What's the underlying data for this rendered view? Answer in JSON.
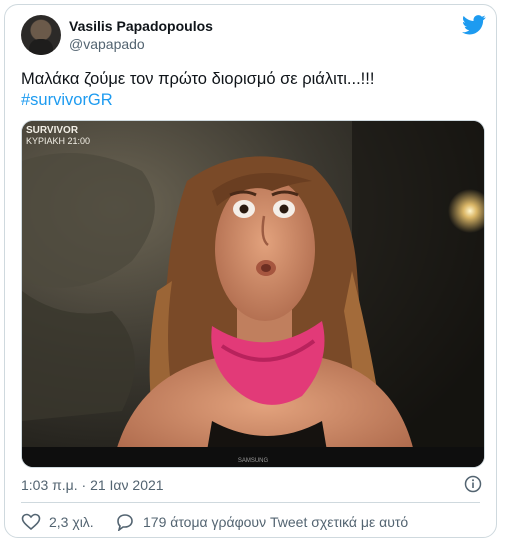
{
  "author": {
    "name": "Vasilis Papadopoulos",
    "handle": "@vapapado"
  },
  "tweet": {
    "text": "Μαλάκα ζούμε τον πρώτο διορισμό σε ριάλιτι...!!!",
    "hashtag": "#survivorGR",
    "timestamp": "1:03 π.μ. · 21 Ιαν 2021"
  },
  "media": {
    "overlay_title": "SURVIVOR",
    "overlay_subtitle": "ΚΥΡΙΑΚΗ 21:00",
    "tv_brand": "SAMSUNG"
  },
  "actions": {
    "likes": "2,3 χιλ.",
    "replies": "179 άτομα γράφουν Tweet σχετικά με αυτό"
  },
  "colors": {
    "accent": "#1d9bf0",
    "muted": "#536471",
    "border": "#cfd9de"
  }
}
